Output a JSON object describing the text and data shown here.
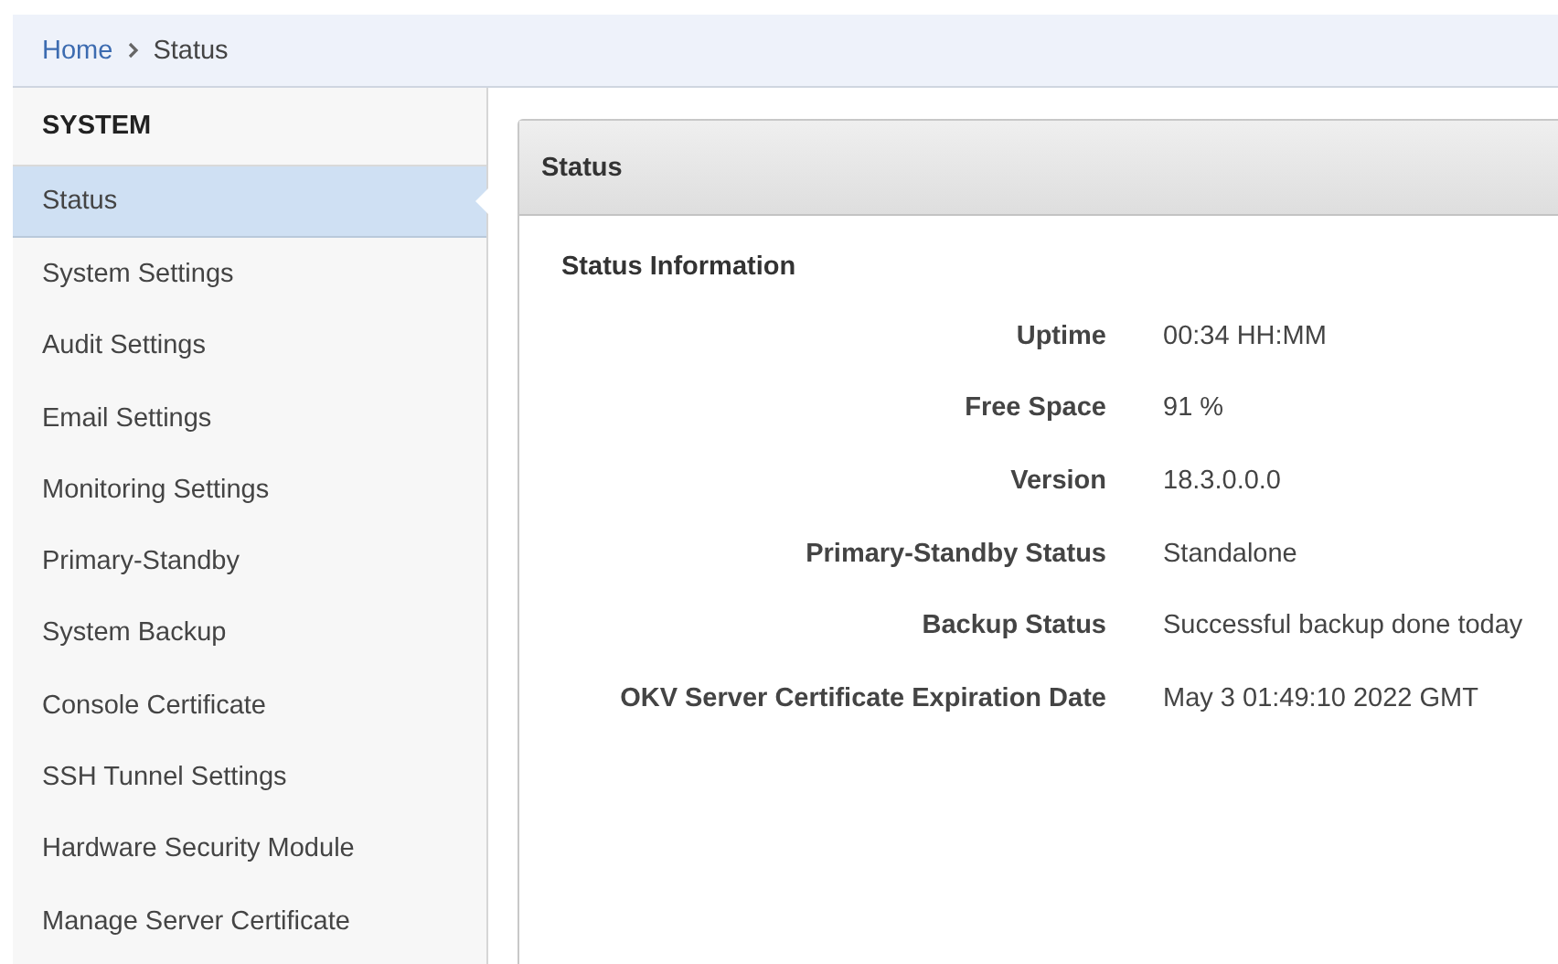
{
  "breadcrumb": {
    "items": [
      "Home",
      "Status"
    ]
  },
  "sidebar": {
    "heading": "SYSTEM",
    "items": [
      {
        "label": "Status",
        "selected": true
      },
      {
        "label": "System Settings",
        "selected": false
      },
      {
        "label": "Audit Settings",
        "selected": false
      },
      {
        "label": "Email Settings",
        "selected": false
      },
      {
        "label": "Monitoring Settings",
        "selected": false
      },
      {
        "label": "Primary-Standby",
        "selected": false
      },
      {
        "label": "System Backup",
        "selected": false
      },
      {
        "label": "Console Certificate",
        "selected": false
      },
      {
        "label": "SSH Tunnel Settings",
        "selected": false
      },
      {
        "label": "Hardware Security Module",
        "selected": false
      },
      {
        "label": "Manage Server Certificate",
        "selected": false
      }
    ]
  },
  "panel": {
    "title": "Status",
    "section": "Status Information",
    "rows": [
      {
        "label": "Uptime",
        "value": "00:34 HH:MM"
      },
      {
        "label": "Free Space",
        "value": "91 %"
      },
      {
        "label": "Version",
        "value": "18.3.0.0.0"
      },
      {
        "label": "Primary-Standby Status",
        "value": "Standalone"
      },
      {
        "label": "Backup Status",
        "value": "Successful backup done today"
      },
      {
        "label": "OKV Server Certificate Expiration Date",
        "value": "May 3 01:49:10 2022 GMT"
      }
    ]
  }
}
